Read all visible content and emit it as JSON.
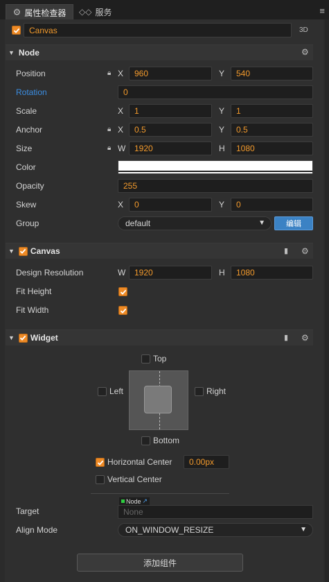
{
  "tabs": {
    "inspector": "属性检查器",
    "services": "服务"
  },
  "node_header": {
    "name": "Canvas",
    "mode_3d": "3D"
  },
  "node": {
    "title": "Node",
    "position": {
      "label": "Position",
      "x_axis": "X",
      "x": "960",
      "y_axis": "Y",
      "y": "540"
    },
    "rotation": {
      "label": "Rotation",
      "value": "0"
    },
    "scale": {
      "label": "Scale",
      "x_axis": "X",
      "x": "1",
      "y_axis": "Y",
      "y": "1"
    },
    "anchor": {
      "label": "Anchor",
      "x_axis": "X",
      "x": "0.5",
      "y_axis": "Y",
      "y": "0.5"
    },
    "size": {
      "label": "Size",
      "w_axis": "W",
      "w": "1920",
      "h_axis": "H",
      "h": "1080"
    },
    "color": {
      "label": "Color",
      "value": "#ffffff"
    },
    "opacity": {
      "label": "Opacity",
      "value": "255"
    },
    "skew": {
      "label": "Skew",
      "x_axis": "X",
      "x": "0",
      "y_axis": "Y",
      "y": "0"
    },
    "group": {
      "label": "Group",
      "value": "default",
      "edit": "编辑"
    }
  },
  "canvas": {
    "title": "Canvas",
    "design_resolution": {
      "label": "Design Resolution",
      "w_axis": "W",
      "w": "1920",
      "h_axis": "H",
      "h": "1080"
    },
    "fit_height": {
      "label": "Fit Height",
      "checked": true
    },
    "fit_width": {
      "label": "Fit Width",
      "checked": true
    }
  },
  "widget": {
    "title": "Widget",
    "top": "Top",
    "left": "Left",
    "right": "Right",
    "bottom": "Bottom",
    "horizontal_center": {
      "label": "Horizontal Center",
      "checked": true,
      "value": "0.00px"
    },
    "vertical_center": {
      "label": "Vertical Center",
      "checked": false
    },
    "target": {
      "label": "Target",
      "tag": "Node",
      "placeholder": "None"
    },
    "align_mode": {
      "label": "Align Mode",
      "value": "ON_WINDOW_RESIZE"
    }
  },
  "add_component": "添加组件",
  "colors": {
    "accent": "#f39a2c",
    "checkbox": "#ee8a25",
    "rotation_label": "#3b8ee3",
    "edit_button": "#3b82c4"
  }
}
